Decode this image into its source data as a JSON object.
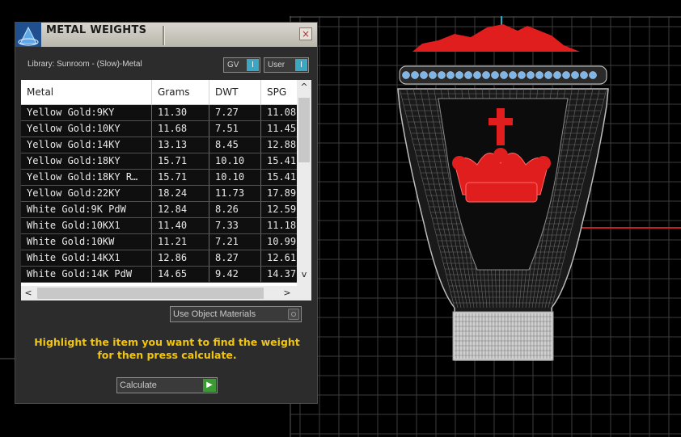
{
  "panel": {
    "title": "METAL WEIGHTS",
    "close_glyph": "×",
    "library_label": "Library: Sunroom - (Slow)-Metal",
    "toggles": [
      {
        "label": "GV",
        "knob": "I"
      },
      {
        "label": "User",
        "knob": "I"
      }
    ],
    "table": {
      "columns": [
        "Metal",
        "Grams",
        "DWT",
        "SPG"
      ],
      "rows": [
        [
          "Yellow Gold:9KY",
          "11.30",
          "7.27",
          "11.08"
        ],
        [
          "Yellow Gold:10KY",
          "11.68",
          "7.51",
          "11.45"
        ],
        [
          "Yellow Gold:14KY",
          "13.13",
          "8.45",
          "12.88"
        ],
        [
          "Yellow Gold:18KY",
          "15.71",
          "10.10",
          "15.41"
        ],
        [
          "Yellow Gold:18KY R…",
          "15.71",
          "10.10",
          "15.41"
        ],
        [
          "Yellow Gold:22KY",
          "18.24",
          "11.73",
          "17.89"
        ],
        [
          "White Gold:9K PdW",
          "12.84",
          "8.26",
          "12.59"
        ],
        [
          "White Gold:10KX1",
          "11.40",
          "7.33",
          "11.18"
        ],
        [
          "White Gold:10KW",
          "11.21",
          "7.21",
          "10.99"
        ],
        [
          "White Gold:14KX1",
          "12.86",
          "8.27",
          "12.61"
        ],
        [
          "White Gold:14K PdW",
          "14.65",
          "9.42",
          "14.37"
        ]
      ],
      "scroll_up": "^",
      "scroll_down": "v",
      "scroll_left": "<",
      "scroll_right": ">"
    },
    "use_object_materials": "Use Object Materials",
    "hint": "Highlight the item you want to find the weight for then press calculate.",
    "calculate_label": "Calculate"
  },
  "colors": {
    "hint": "#f1c40f",
    "toggle_knob": "#3aa8c4",
    "calculate_go": "#3c9a32",
    "model_accent": "#e01e1e",
    "gem_blue": "#7fb6e8"
  }
}
